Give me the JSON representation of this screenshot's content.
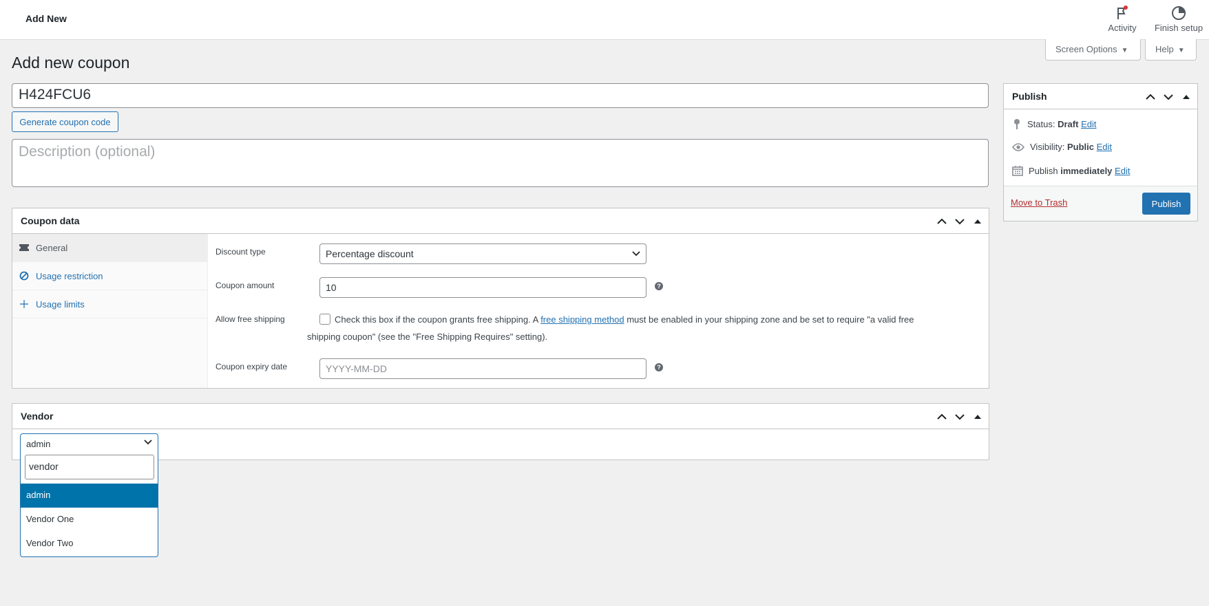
{
  "topbar": {
    "breadcrumb": "Add New",
    "activity_label": "Activity",
    "finish_setup_label": "Finish setup"
  },
  "screen_options": {
    "label": "Screen Options"
  },
  "help": {
    "label": "Help"
  },
  "page": {
    "title": "Add new coupon",
    "coupon_code": "H424FCU6",
    "generate_label": "Generate coupon code",
    "description_placeholder": "Description (optional)"
  },
  "coupon_data": {
    "title": "Coupon data",
    "tabs": [
      {
        "label": "General",
        "icon": "ticket-icon"
      },
      {
        "label": "Usage restriction",
        "icon": "ban-icon"
      },
      {
        "label": "Usage limits",
        "icon": "plus-icon"
      }
    ],
    "discount_type": {
      "label": "Discount type",
      "value": "Percentage discount"
    },
    "coupon_amount": {
      "label": "Coupon amount",
      "value": "10"
    },
    "free_shipping": {
      "label": "Allow free shipping",
      "text_before": "Check this box if the coupon grants free shipping. A ",
      "link": "free shipping method",
      "text_after": " must be enabled in your shipping zone and be set to require \"a valid free shipping coupon\" (see the \"Free Shipping Requires\" setting)."
    },
    "expiry": {
      "label": "Coupon expiry date",
      "placeholder": "YYYY-MM-DD"
    }
  },
  "vendor": {
    "title": "Vendor",
    "selected": "admin",
    "search": "vendor",
    "options": [
      "admin",
      "Vendor One",
      "Vendor Two"
    ]
  },
  "publish": {
    "title": "Publish",
    "status_label": "Status:",
    "status_value": "Draft",
    "visibility_label": "Visibility:",
    "visibility_value": "Public",
    "publish_label": "Publish",
    "publish_value": "immediately",
    "edit_label": "Edit",
    "trash_label": "Move to Trash",
    "publish_button": "Publish"
  },
  "colors": {
    "primary": "#2271b1",
    "highlight": "#0073aa",
    "danger": "#b32d2e",
    "background": "#f0f0f1"
  }
}
